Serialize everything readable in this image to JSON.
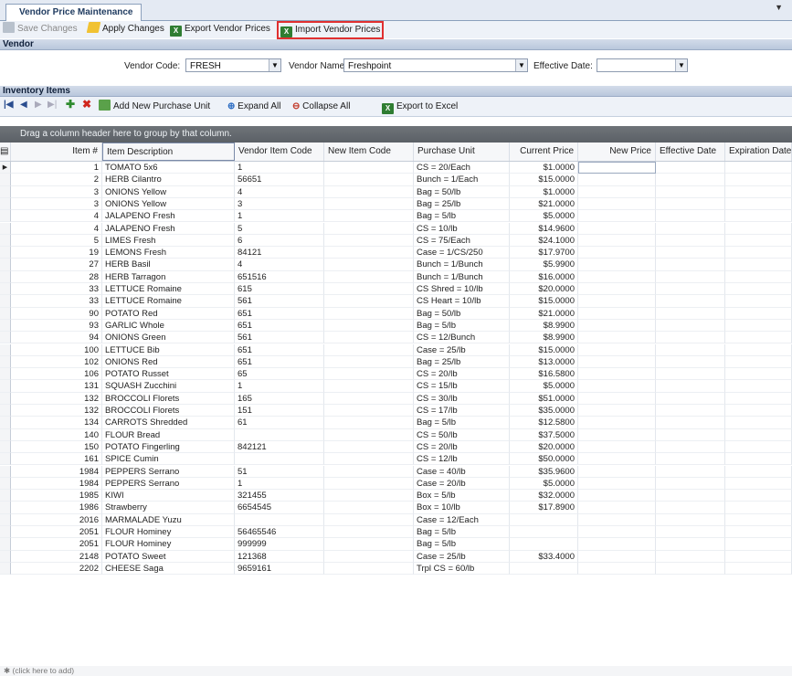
{
  "tab": {
    "title": "Vendor Price Maintenance"
  },
  "toolbar": {
    "save_label": "Save Changes",
    "apply_label": "Apply Changes",
    "export_label": "Export Vendor Prices",
    "import_label": "Import Vendor Prices"
  },
  "vendor": {
    "section_title": "Vendor",
    "code_label": "Vendor Code:",
    "code_value": "FRESH",
    "name_label": "Vendor Name:",
    "name_value": "Freshpoint",
    "date_label": "Effective Date:",
    "date_value": ""
  },
  "inventory": {
    "section_title": "Inventory Items",
    "add_unit_label": "Add New Purchase Unit",
    "expand_label": "Expand All",
    "collapse_label": "Collapse All",
    "excel_label": "Export to Excel",
    "group_hint": "Drag a column header here to group by that column.",
    "add_row_hint": "(click here to add)"
  },
  "grid": {
    "columns": [
      "Item #",
      "Item Description",
      "Vendor Item Code",
      "New Item Code",
      "Purchase Unit",
      "Current Price",
      "New Price",
      "Effective Date",
      "Expiration Date"
    ],
    "rows": [
      [
        "1",
        "TOMATO 5x6",
        "1",
        "",
        "CS = 20/Each",
        "$1.0000"
      ],
      [
        "2",
        "HERB Cilantro",
        "56651",
        "",
        "Bunch = 1/Each",
        "$15.0000"
      ],
      [
        "3",
        "ONIONS Yellow",
        "4",
        "",
        "Bag = 50/lb",
        "$1.0000"
      ],
      [
        "3",
        "ONIONS Yellow",
        "3",
        "",
        "Bag = 25/lb",
        "$21.0000"
      ],
      [
        "4",
        "JALAPENO Fresh",
        "1",
        "",
        "Bag = 5/lb",
        "$5.0000"
      ],
      [
        "4",
        "JALAPENO Fresh",
        "5",
        "",
        "CS = 10/lb",
        "$14.9600"
      ],
      [
        "5",
        "LIMES Fresh",
        "6",
        "",
        "CS = 75/Each",
        "$24.1000"
      ],
      [
        "19",
        "LEMONS Fresh",
        "84121",
        "",
        "Case = 1/CS/250",
        "$17.9700"
      ],
      [
        "27",
        "HERB Basil",
        "4",
        "",
        "Bunch = 1/Bunch",
        "$5.9900"
      ],
      [
        "28",
        "HERB Tarragon",
        "651516",
        "",
        "Bunch = 1/Bunch",
        "$16.0000"
      ],
      [
        "33",
        "LETTUCE Romaine",
        "615",
        "",
        "CS Shred = 10/lb",
        "$20.0000"
      ],
      [
        "33",
        "LETTUCE Romaine",
        "561",
        "",
        "CS Heart = 10/lb",
        "$15.0000"
      ],
      [
        "90",
        "POTATO Red",
        "651",
        "",
        "Bag = 50/lb",
        "$21.0000"
      ],
      [
        "93",
        "GARLIC Whole",
        "651",
        "",
        "Bag = 5/lb",
        "$8.9900"
      ],
      [
        "94",
        "ONIONS Green",
        "561",
        "",
        "CS = 12/Bunch",
        "$8.9900"
      ],
      [
        "100",
        "LETTUCE Bib",
        "651",
        "",
        "Case = 25/lb",
        "$15.0000"
      ],
      [
        "102",
        "ONIONS Red",
        "651",
        "",
        "Bag = 25/lb",
        "$13.0000"
      ],
      [
        "106",
        "POTATO Russet",
        "65",
        "",
        "CS = 20/lb",
        "$16.5800"
      ],
      [
        "131",
        "SQUASH Zucchini",
        "1",
        "",
        "CS = 15/lb",
        "$5.0000"
      ],
      [
        "132",
        "BROCCOLI Florets",
        "165",
        "",
        "CS = 30/lb",
        "$51.0000"
      ],
      [
        "132",
        "BROCCOLI Florets",
        "151",
        "",
        "CS = 17/lb",
        "$35.0000"
      ],
      [
        "134",
        "CARROTS Shredded",
        "61",
        "",
        "Bag = 5/lb",
        "$12.5800"
      ],
      [
        "140",
        "FLOUR Bread",
        "",
        "",
        "CS = 50/lb",
        "$37.5000"
      ],
      [
        "150",
        "POTATO Fingerling",
        "842121",
        "",
        "CS = 20/lb",
        "$20.0000"
      ],
      [
        "161",
        "SPICE Cumin",
        "",
        "",
        "CS = 12/lb",
        "$50.0000"
      ],
      [
        "1984",
        "PEPPERS Serrano",
        "51",
        "",
        "Case = 40/lb",
        "$35.9600"
      ],
      [
        "1984",
        "PEPPERS Serrano",
        "1",
        "",
        "Case = 20/lb",
        "$5.0000"
      ],
      [
        "1985",
        "KIWI",
        "321455",
        "",
        "Box = 5/lb",
        "$32.0000"
      ],
      [
        "1986",
        "Strawberry",
        "6654545",
        "",
        "Box = 10/lb",
        "$17.8900"
      ],
      [
        "2016",
        "MARMALADE Yuzu",
        "",
        "",
        "Case = 12/Each",
        ""
      ],
      [
        "2051",
        "FLOUR Hominey",
        "56465546",
        "",
        "Bag = 5/lb",
        ""
      ],
      [
        "2051",
        "FLOUR Hominey",
        "999999",
        "",
        "Bag  = 5/lb",
        ""
      ],
      [
        "2148",
        "POTATO Sweet",
        "121368",
        "",
        "Case = 25/lb",
        "$33.4000"
      ],
      [
        "2202",
        "CHEESE Saga",
        "9659161",
        "",
        "Trpl CS = 60/lb",
        ""
      ]
    ]
  }
}
